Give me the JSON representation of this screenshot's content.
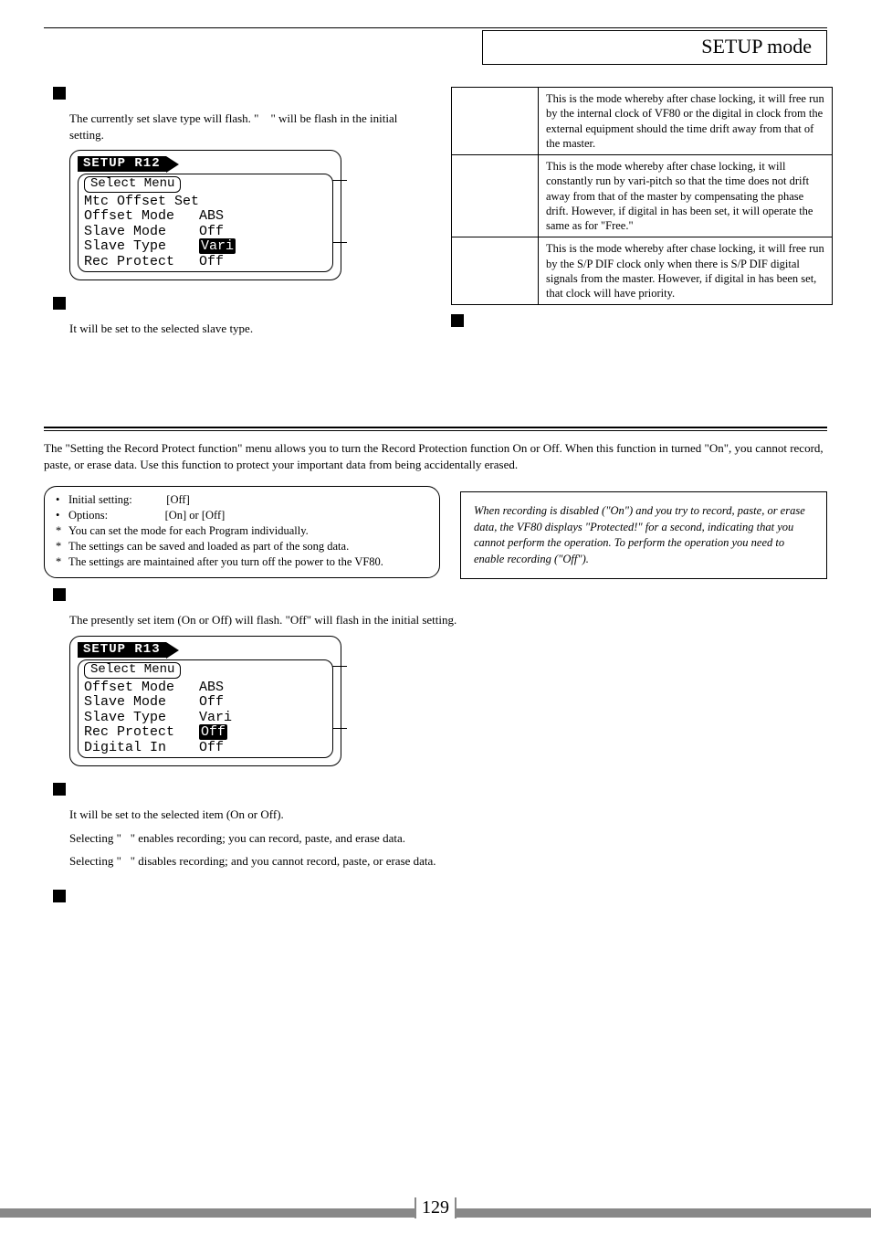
{
  "header": {
    "title": "SETUP mode"
  },
  "left": {
    "para1_a": "The currently set slave type will flash. \"",
    "para1_b": "\" will be flash in the initial setting.",
    "para2": "It will be set to the selected slave type."
  },
  "lcd1": {
    "title": "SETUP R12",
    "menu": "Select Menu",
    "r1a": "Mtc Offset Set",
    "r2a": "Offset Mode",
    "r2b": "ABS",
    "r3a": "Slave Mode",
    "r3b": "Off",
    "r4a": "Slave Type",
    "r4b": "Vari",
    "r5a": "Rec Protect",
    "r5b": "Off"
  },
  "table": {
    "r1": "This is the mode whereby after chase locking, it will free run by the internal clock of VF80 or the digital in clock from the external equipment should the time drift away from that of the master.",
    "r2": "This is the mode whereby after chase locking, it will constantly run by vari-pitch so that the time does not drift away from that of the master by compensating the phase drift. However, if digital in has been set, it will operate the same as for \"Free.\"",
    "r3": "This is the mode whereby after chase locking, it will free run by the S/P DIF clock only when there is S/P DIF digital signals from the master. However, if digital in has been set, that clock will have priority."
  },
  "intro": "The \"Setting the Record Protect function\" menu allows you to turn the Record Protection function On or Off. When this function in turned \"On\", you cannot record, paste, or erase data.  Use this function to protect your important data from being accidentally erased.",
  "bullets": {
    "b1a": "Initial setting:",
    "b1b": "[Off]",
    "b2a": "Options:",
    "b2b": "[On] or [Off]",
    "s1": "You can set the mode for each Program individually.",
    "s2": "The settings can be saved and loaded as part of the song data.",
    "s3": "The settings are maintained after you turn off the power to the VF80."
  },
  "note": "When recording is disabled (\"On\") and you try to record, paste, or erase data, the VF80 displays \"Protected!\" for a second, indicating that you cannot perform the operation. To perform the operation you need to enable recording (\"Off\").",
  "lower": {
    "para1": "The presently set item (On or Off) will flash. \"Off\" will flash in the initial setting.",
    "para2": "It will be set to the selected item (On or Off).",
    "para3a": "Selecting \"",
    "para3b": "\" enables recording; you can record, paste, and erase data.",
    "para4a": "Selecting \"",
    "para4b": "\" disables recording; and you cannot record, paste, or erase data."
  },
  "lcd2": {
    "title": "SETUP R13",
    "menu": "Select Menu",
    "r1a": "Offset Mode",
    "r1b": "ABS",
    "r2a": "Slave Mode",
    "r2b": "Off",
    "r3a": "Slave Type",
    "r3b": "Vari",
    "r4a": "Rec Protect",
    "r4b": "Off",
    "r5a": "Digital In",
    "r5b": "Off"
  },
  "page_number": "129"
}
